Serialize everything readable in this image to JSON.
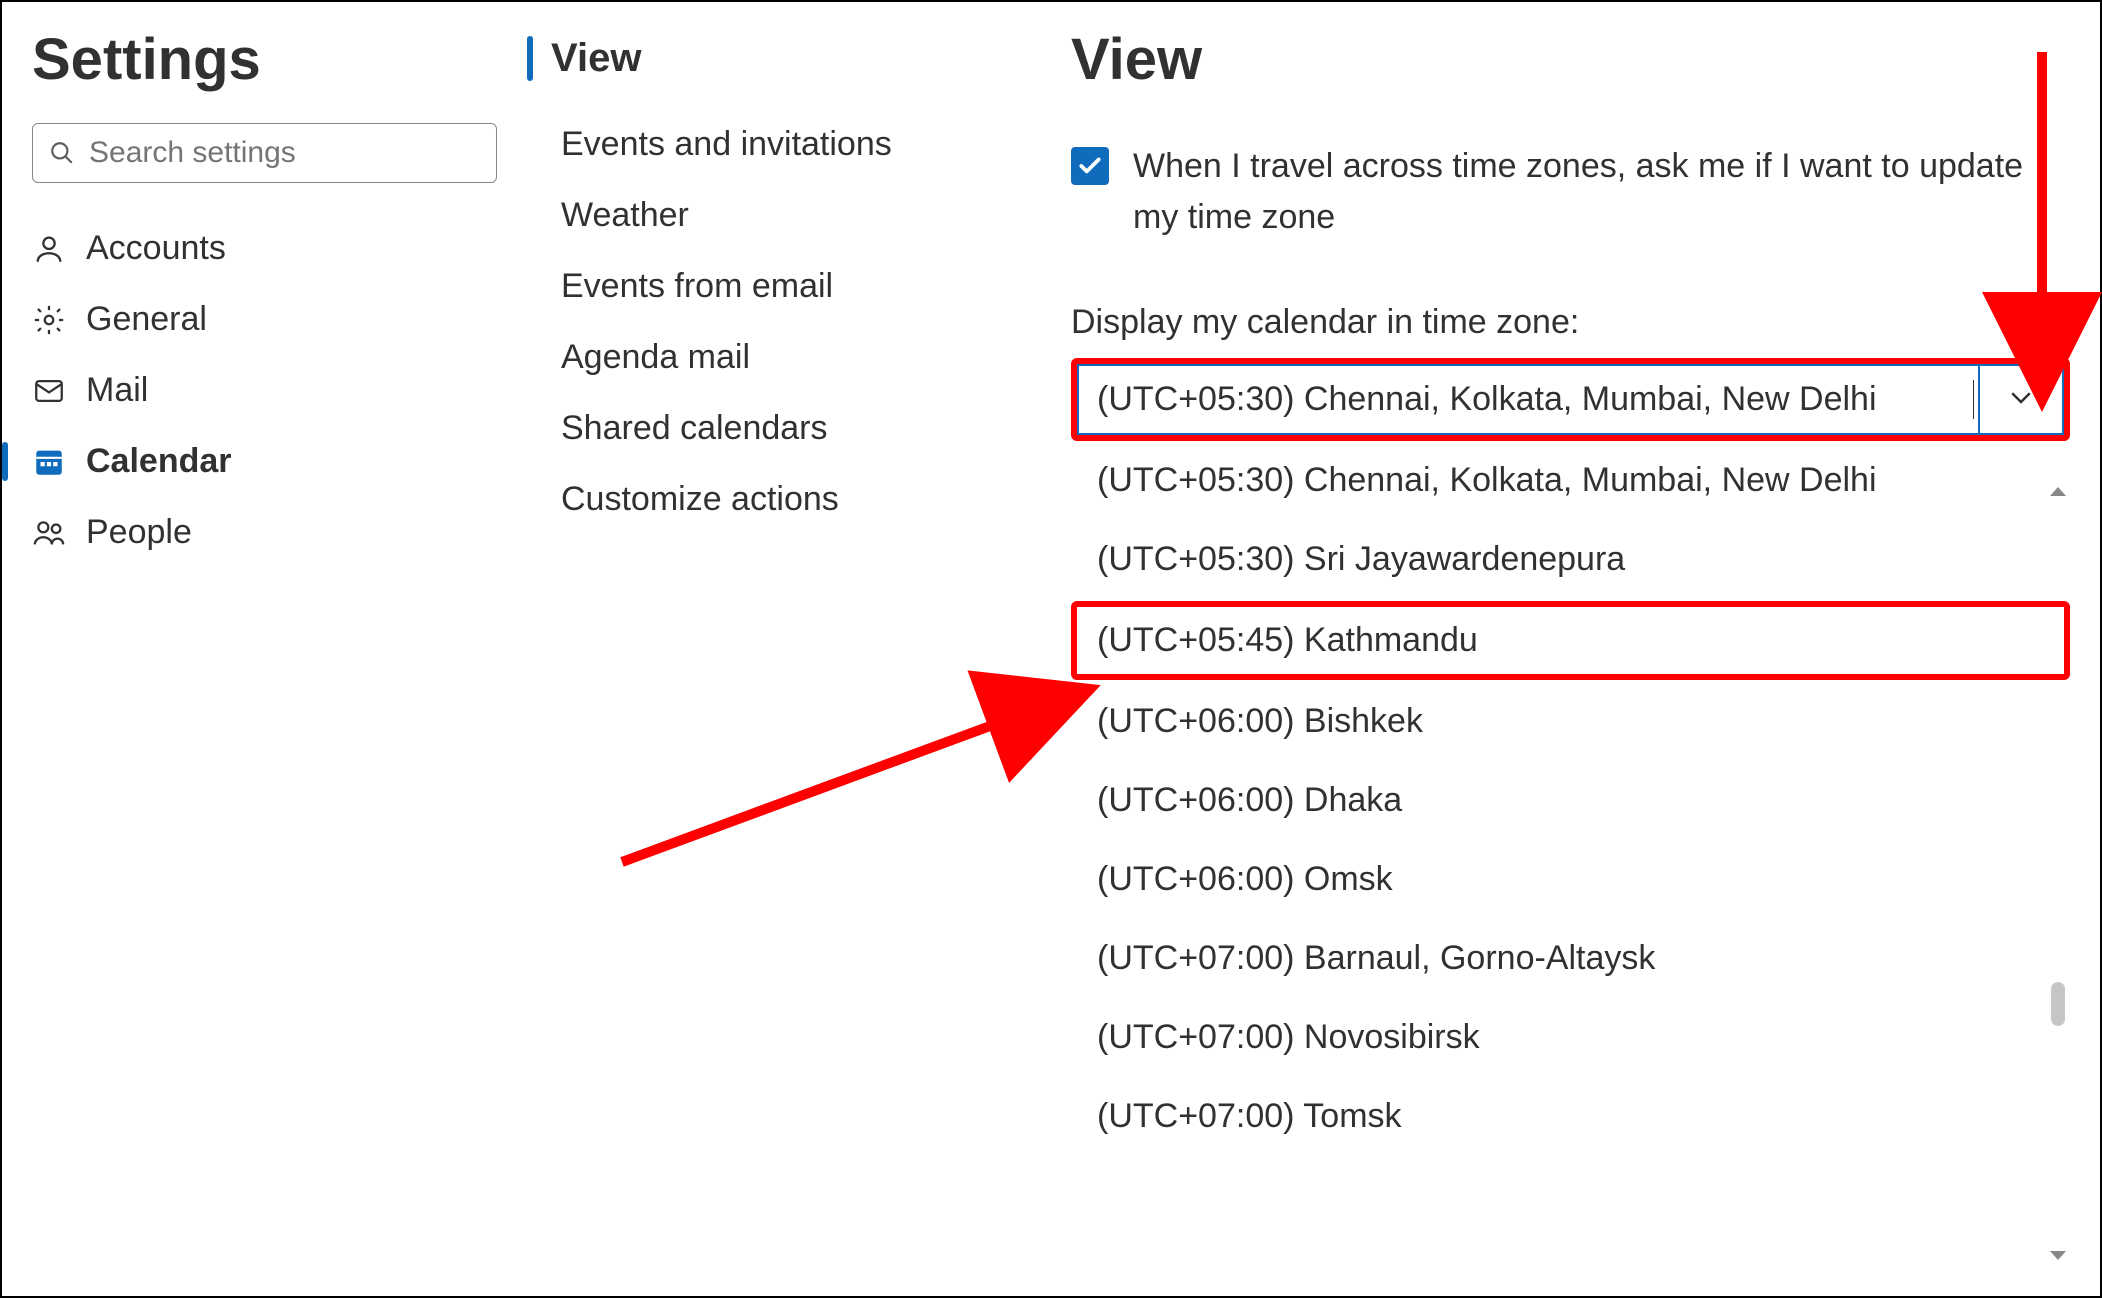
{
  "col1": {
    "title": "Settings",
    "search_placeholder": "Search settings",
    "nav": [
      {
        "key": "accounts",
        "label": "Accounts"
      },
      {
        "key": "general",
        "label": "General"
      },
      {
        "key": "mail",
        "label": "Mail"
      },
      {
        "key": "calendar",
        "label": "Calendar",
        "active": true
      },
      {
        "key": "people",
        "label": "People"
      }
    ]
  },
  "col2": {
    "heading": "View",
    "items": [
      "Events and invitations",
      "Weather",
      "Events from email",
      "Agenda mail",
      "Shared calendars",
      "Customize actions"
    ]
  },
  "col3": {
    "heading": "View",
    "checkbox_checked": true,
    "checkbox_label": "When I travel across time zones, ask me if I want to update my time zone",
    "tz_label": "Display my calendar in time zone:",
    "tz_selected": "(UTC+05:30) Chennai, Kolkata, Mumbai, New Delhi",
    "tz_options": [
      "(UTC+05:30) Chennai, Kolkata, Mumbai, New Delhi",
      "(UTC+05:30) Sri Jayawardenepura",
      "(UTC+05:45) Kathmandu",
      "(UTC+06:00) Bishkek",
      "(UTC+06:00) Dhaka",
      "(UTC+06:00) Omsk",
      "(UTC+07:00) Barnaul, Gorno-Altaysk",
      "(UTC+07:00) Novosibirsk",
      "(UTC+07:00) Tomsk"
    ],
    "highlight_index": 2
  }
}
